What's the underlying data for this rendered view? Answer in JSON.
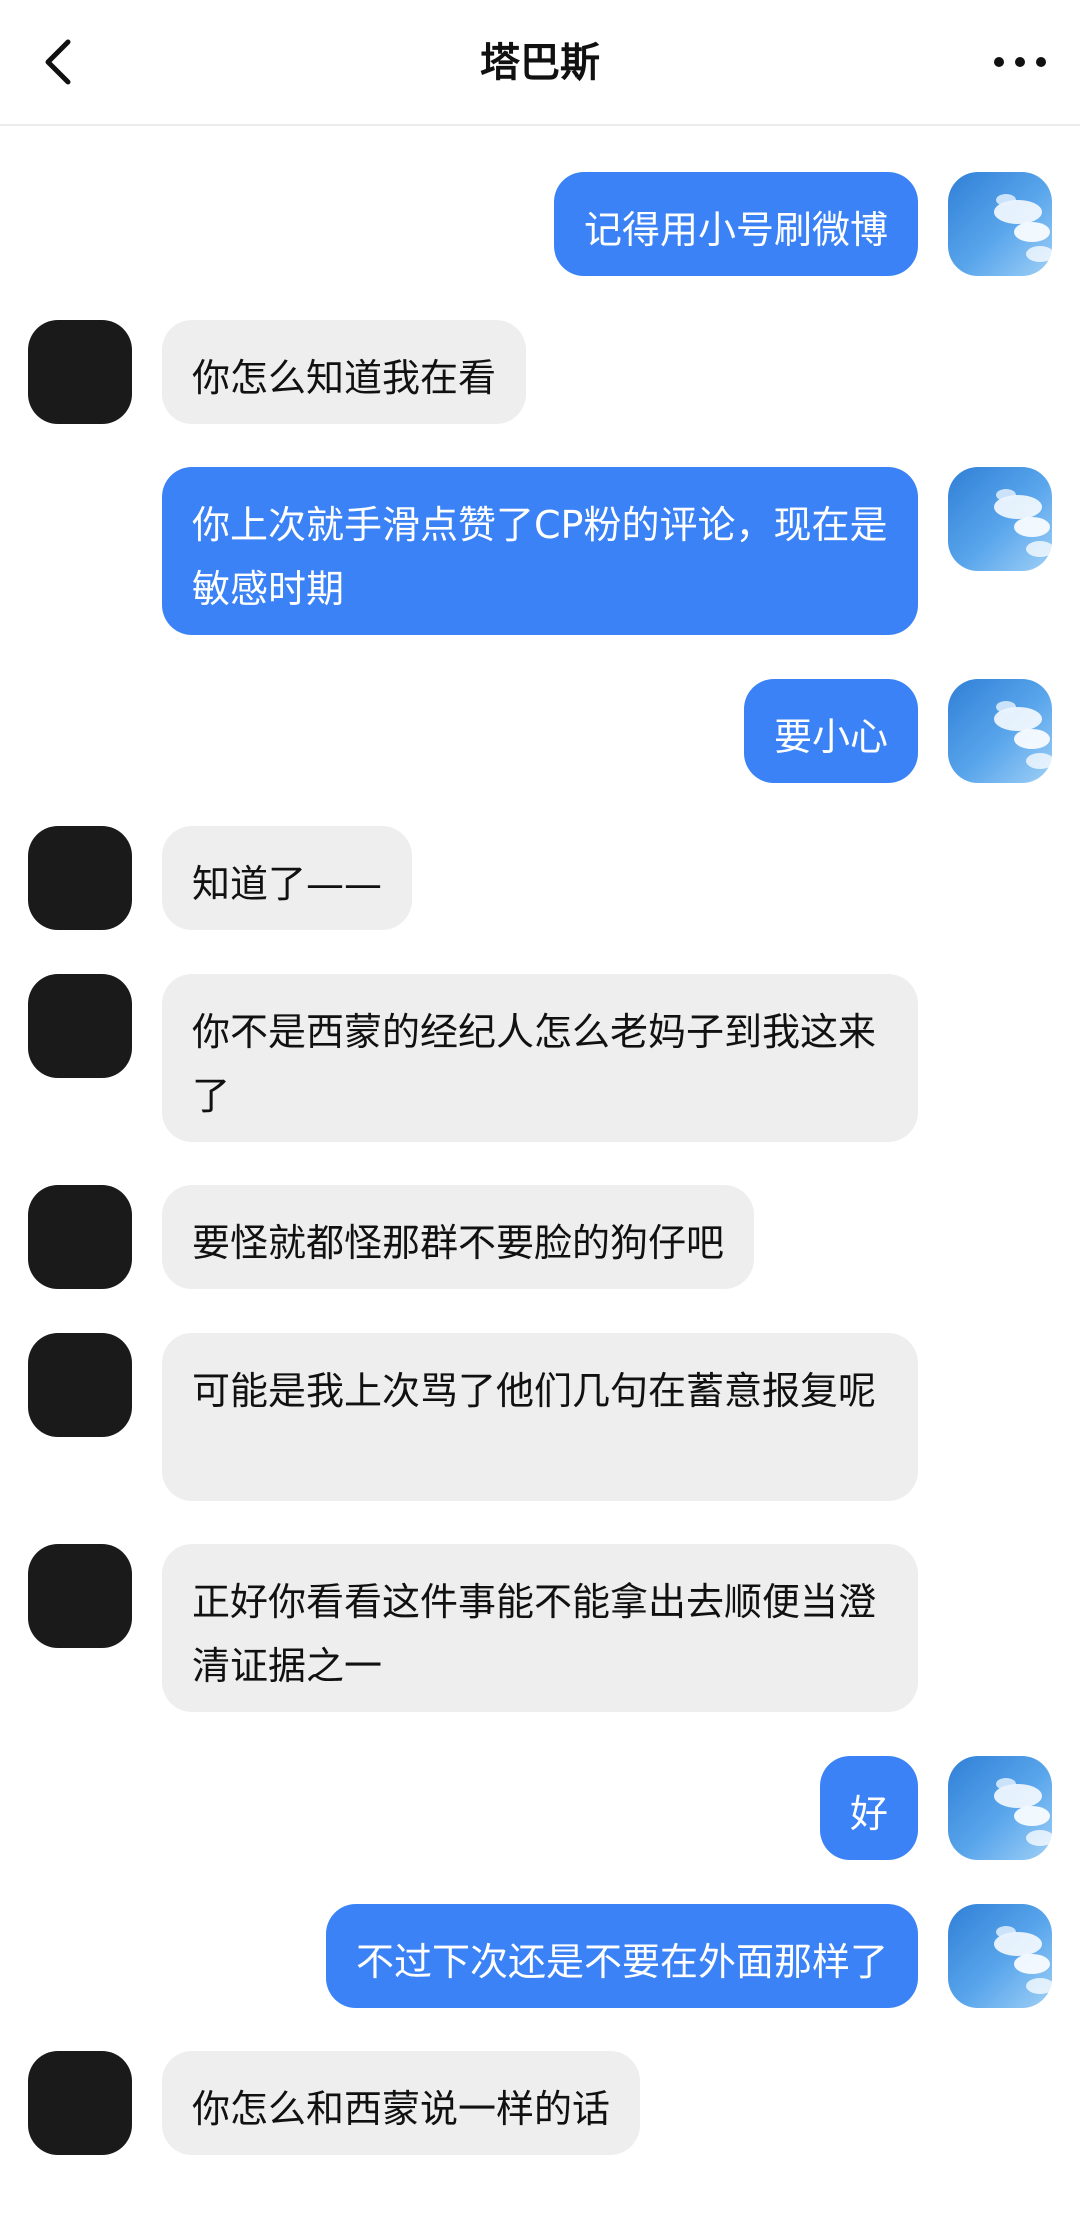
{
  "header": {
    "title": "塔巴斯",
    "back_icon": "chevron-left-icon",
    "more_icon": "more-horizontal-icon"
  },
  "colors": {
    "sent_bubble": "#3b82f6",
    "recv_bubble": "#eeeeee",
    "recv_avatar": "#1a1a1a"
  },
  "messages": [
    {
      "side": "sent",
      "text": "记得用小号刷微博"
    },
    {
      "side": "recv",
      "text": "你怎么知道我在看"
    },
    {
      "side": "sent",
      "text": "你上次就手滑点赞了CP粉的评论，现在是敏感时期"
    },
    {
      "side": "sent",
      "text": "要小心"
    },
    {
      "side": "recv",
      "text": "知道了——"
    },
    {
      "side": "recv",
      "text": "你不是西蒙的经纪人怎么老妈子到我这来了"
    },
    {
      "side": "recv",
      "text": "要怪就都怪那群不要脸的狗仔吧"
    },
    {
      "side": "recv",
      "text": "可能是我上次骂了他们几句在蓄意报复呢"
    },
    {
      "side": "recv",
      "text": "正好你看看这件事能不能拿出去顺便当澄清证据之一"
    },
    {
      "side": "sent",
      "text": "好"
    },
    {
      "side": "sent",
      "text": "不过下次还是不要在外面那样了"
    },
    {
      "side": "recv",
      "text": "你怎么和西蒙说一样的话"
    }
  ]
}
